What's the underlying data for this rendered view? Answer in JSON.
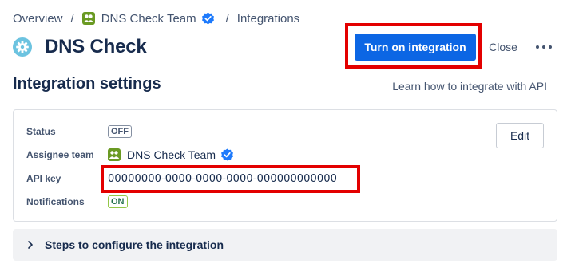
{
  "breadcrumb": {
    "items": [
      "Overview",
      "DNS Check Team",
      "Integrations"
    ],
    "separator": "/"
  },
  "header": {
    "title": "DNS Check",
    "primary_button": "Turn on integration",
    "close_button": "Close"
  },
  "settings": {
    "section_title": "Integration settings",
    "learn_link": "Learn how to integrate with API",
    "edit_button": "Edit",
    "rows": [
      {
        "label": "Status",
        "value": "OFF"
      },
      {
        "label": "Assignee team",
        "value": "DNS Check Team"
      },
      {
        "label": "API key",
        "value": "00000000-0000-0000-0000-000000000000"
      },
      {
        "label": "Notifications",
        "value": "ON"
      }
    ]
  },
  "steps": {
    "label": "Steps to configure the integration"
  },
  "colors": {
    "primary": "#0c66e4",
    "highlight": "#e30000",
    "verified": "#1d7afc",
    "team_icon": "#6a9a23",
    "gear": "#6cc3e0"
  },
  "icons": [
    "team-icon",
    "verified-icon",
    "gear-icon",
    "more-icon",
    "chevron-right-icon"
  ]
}
